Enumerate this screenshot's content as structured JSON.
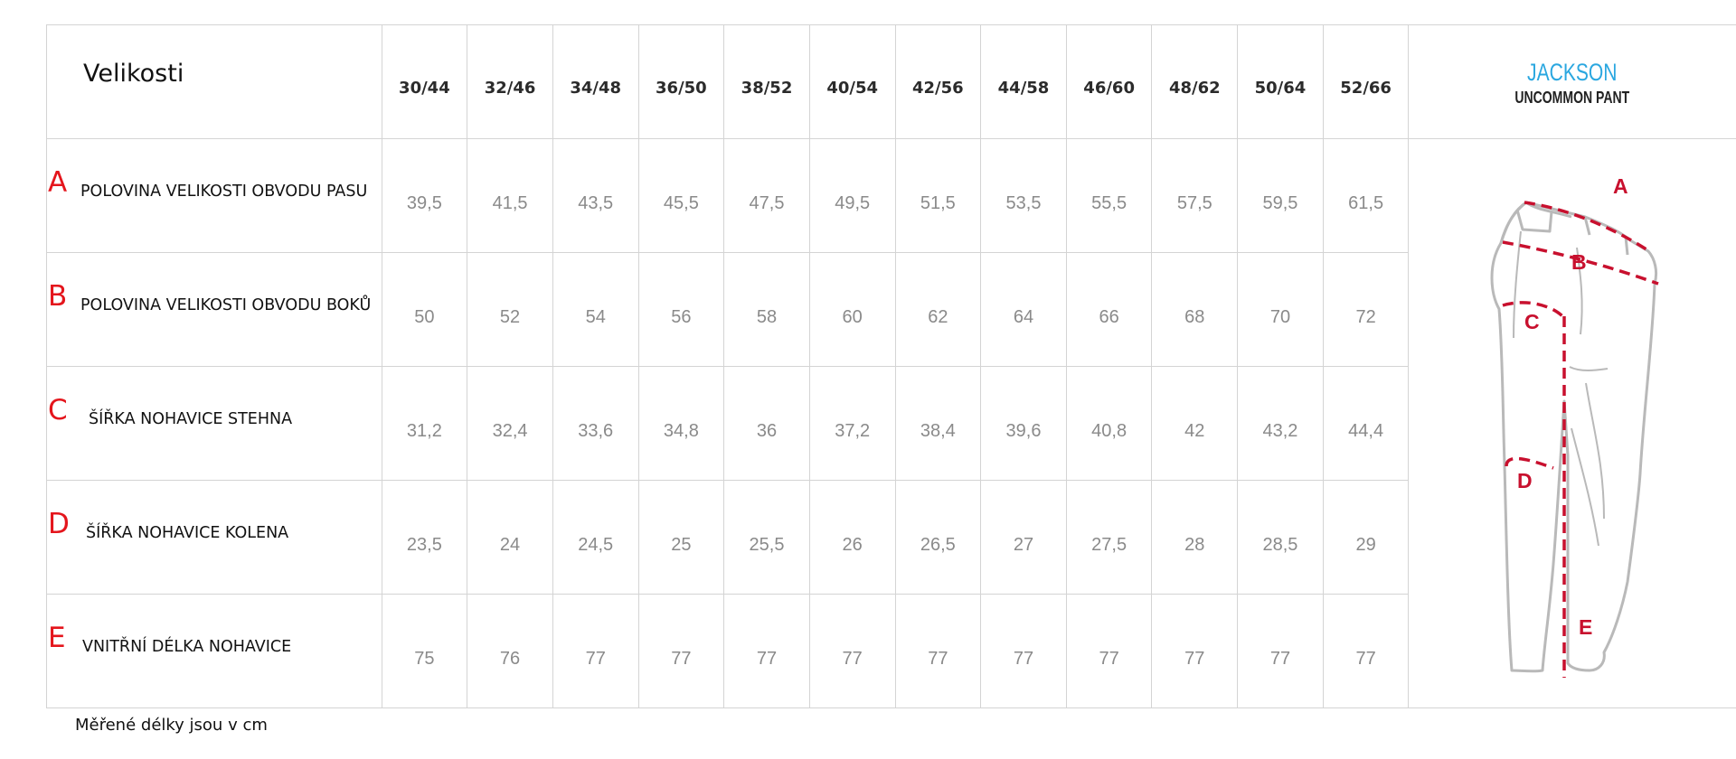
{
  "title": "Velikosti",
  "sizes": [
    "30/44",
    "32/46",
    "34/48",
    "36/50",
    "38/52",
    "40/54",
    "42/56",
    "44/58",
    "46/60",
    "48/62",
    "50/64",
    "52/66"
  ],
  "brand": {
    "name": "JACKSON",
    "subtitle": "UNCOMMON PANT"
  },
  "rows": [
    {
      "letter": "A",
      "label": "POLOVINA VELIKOSTI OBVODU PASU",
      "values": [
        "39,5",
        "41,5",
        "43,5",
        "45,5",
        "47,5",
        "49,5",
        "51,5",
        "53,5",
        "55,5",
        "57,5",
        "59,5",
        "61,5"
      ]
    },
    {
      "letter": "B",
      "label": "POLOVINA VELIKOSTI OBVODU BOKŮ",
      "values": [
        "50",
        "52",
        "54",
        "56",
        "58",
        "60",
        "62",
        "64",
        "66",
        "68",
        "70",
        "72"
      ]
    },
    {
      "letter": "C",
      "label": "ŠÍŘKA NOHAVICE STEHNA",
      "values": [
        "31,2",
        "32,4",
        "33,6",
        "34,8",
        "36",
        "37,2",
        "38,4",
        "39,6",
        "40,8",
        "42",
        "43,2",
        "44,4"
      ]
    },
    {
      "letter": "D",
      "label": "ŠÍŘKA NOHAVICE KOLENA",
      "values": [
        "23,5",
        "24",
        "24,5",
        "25",
        "25,5",
        "26",
        "26,5",
        "27",
        "27,5",
        "28",
        "28,5",
        "29"
      ]
    },
    {
      "letter": "E",
      "label": "VNITŘNÍ DÉLKA NOHAVICE",
      "values": [
        "75",
        "76",
        "77",
        "77",
        "77",
        "77",
        "77",
        "77",
        "77",
        "77",
        "77",
        "77"
      ]
    }
  ],
  "diagram": {
    "markers": [
      "A",
      "B",
      "C",
      "D",
      "E"
    ]
  },
  "colors": {
    "accent_letter": "#e4151c",
    "brand": "#2aa7e0",
    "measure_line": "#c8102e",
    "values": "#8a8a8a",
    "grid": "#d4d4d4"
  },
  "footnote": "Měřené délky jsou v cm"
}
